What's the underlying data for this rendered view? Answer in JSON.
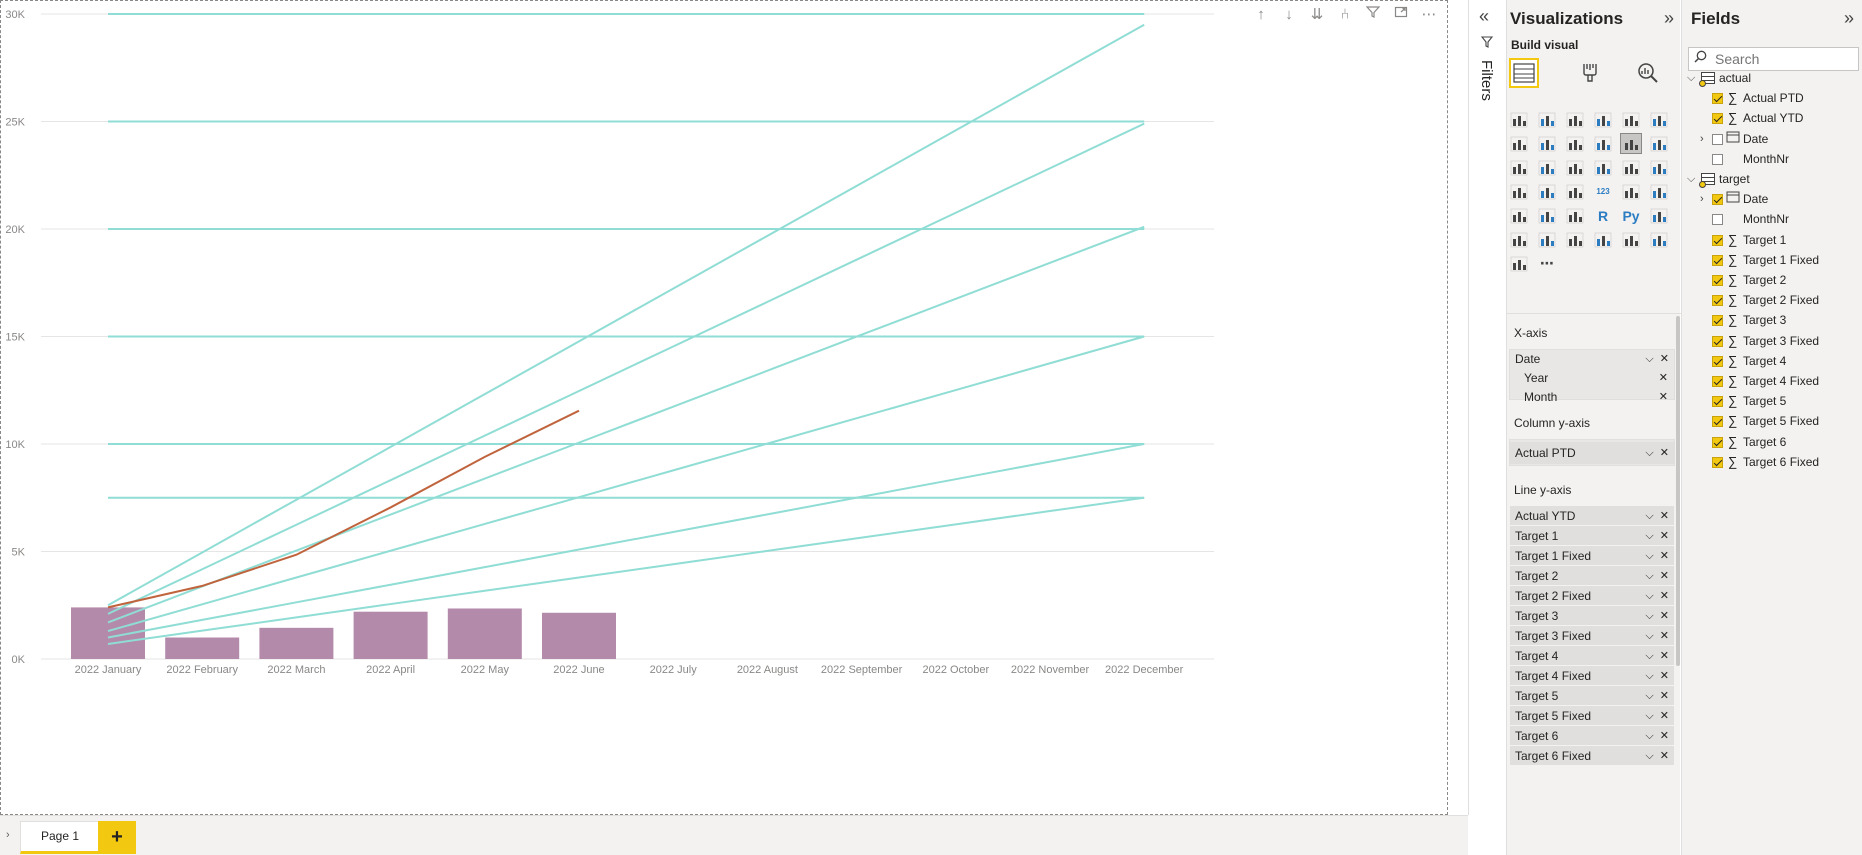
{
  "visual_header": {
    "icons": [
      "arrow-up-icon",
      "arrow-down-icon",
      "double-arrow-down-icon",
      "fork-icon",
      "filter-icon",
      "focus-mode-icon",
      "more-options-icon"
    ],
    "more_label": "⋯"
  },
  "chart_data": {
    "type": "bar-line-combo",
    "categories": [
      "2022 January",
      "2022 February",
      "2022 March",
      "2022 April",
      "2022 May",
      "2022 June",
      "2022 July",
      "2022 August",
      "2022 September",
      "2022 October",
      "2022 November",
      "2022 December"
    ],
    "y_ticks": [
      "0K",
      "5K",
      "10K",
      "15K",
      "20K",
      "25K",
      "30K"
    ],
    "ylim": [
      0,
      30000
    ],
    "grid": true,
    "bar_color": "#b48aab",
    "target_color": "#8fddd4",
    "actual_line_color": "#c0643d",
    "bars": {
      "name": "Actual PTD",
      "values": [
        2400,
        1000,
        1450,
        2200,
        2350,
        2150,
        null,
        null,
        null,
        null,
        null,
        null
      ]
    },
    "actual_line": {
      "name": "Actual YTD",
      "values": [
        2400,
        3400,
        4850,
        7050,
        9400,
        11550,
        null,
        null,
        null,
        null,
        null,
        null
      ]
    },
    "targets_growing": [
      {
        "name": "Target 1",
        "values": [
          2500,
          4955,
          7409,
          9864,
          12318,
          14773,
          17227,
          19682,
          22136,
          24591,
          27045,
          29500
        ]
      },
      {
        "name": "Target 2",
        "values": [
          2100,
          4173,
          6245,
          8318,
          10391,
          12464,
          14536,
          16609,
          18682,
          20755,
          22827,
          24900
        ]
      },
      {
        "name": "Target 3",
        "values": [
          1700,
          3373,
          5045,
          6718,
          8391,
          10064,
          11736,
          13409,
          15082,
          16755,
          18427,
          20100
        ]
      },
      {
        "name": "Target 4",
        "values": [
          1300,
          2545,
          3791,
          5036,
          6282,
          7527,
          8773,
          10018,
          11264,
          12509,
          13755,
          15000
        ]
      },
      {
        "name": "Target 5",
        "values": [
          1000,
          1818,
          2636,
          3455,
          4273,
          5091,
          5909,
          6727,
          7545,
          8364,
          9182,
          10000
        ]
      },
      {
        "name": "Target 6",
        "values": [
          700,
          1318,
          1936,
          2555,
          3173,
          3791,
          4409,
          5027,
          5645,
          6264,
          6882,
          7500
        ]
      }
    ],
    "targets_fixed": [
      {
        "name": "Target 1 Fixed",
        "value": 30000
      },
      {
        "name": "Target 2 Fixed",
        "value": 25000
      },
      {
        "name": "Target 3 Fixed",
        "value": 20000
      },
      {
        "name": "Target 4 Fixed",
        "value": 15000
      },
      {
        "name": "Target 5 Fixed",
        "value": 10000
      },
      {
        "name": "Target 6 Fixed",
        "value": 7500
      }
    ]
  },
  "filters": {
    "label": "Filters"
  },
  "visualizations": {
    "title": "Visualizations",
    "build_label": "Build visual",
    "wells": {
      "x_axis": {
        "title": "X-axis",
        "field": "Date",
        "sub_fields": [
          "Year",
          "Month"
        ]
      },
      "column_y": {
        "title": "Column y-axis",
        "fields": [
          "Actual PTD"
        ]
      },
      "line_y": {
        "title": "Line y-axis",
        "fields": [
          "Actual YTD",
          "Target 1",
          "Target 1 Fixed",
          "Target 2",
          "Target 2 Fixed",
          "Target 3",
          "Target 3 Fixed",
          "Target 4",
          "Target 4 Fixed",
          "Target 5",
          "Target 5 Fixed",
          "Target 6",
          "Target 6 Fixed"
        ]
      }
    }
  },
  "fields": {
    "title": "Fields",
    "search_placeholder": "Search",
    "tables": [
      {
        "name": "actual",
        "items": [
          {
            "label": "Actual PTD",
            "checked": true,
            "type": "measure"
          },
          {
            "label": "Actual YTD",
            "checked": true,
            "type": "measure"
          },
          {
            "label": "Date",
            "checked": false,
            "type": "date"
          },
          {
            "label": "MonthNr",
            "checked": false,
            "type": "plain"
          }
        ]
      },
      {
        "name": "target",
        "items": [
          {
            "label": "Date",
            "checked": true,
            "type": "date"
          },
          {
            "label": "MonthNr",
            "checked": false,
            "type": "plain"
          },
          {
            "label": "Target 1",
            "checked": true,
            "type": "measure"
          },
          {
            "label": "Target 1 Fixed",
            "checked": true,
            "type": "measure"
          },
          {
            "label": "Target 2",
            "checked": true,
            "type": "measure"
          },
          {
            "label": "Target 2 Fixed",
            "checked": true,
            "type": "measure"
          },
          {
            "label": "Target 3",
            "checked": true,
            "type": "measure"
          },
          {
            "label": "Target 3 Fixed",
            "checked": true,
            "type": "measure"
          },
          {
            "label": "Target 4",
            "checked": true,
            "type": "measure"
          },
          {
            "label": "Target 4 Fixed",
            "checked": true,
            "type": "measure"
          },
          {
            "label": "Target 5",
            "checked": true,
            "type": "measure"
          },
          {
            "label": "Target 5 Fixed",
            "checked": true,
            "type": "measure"
          },
          {
            "label": "Target 6",
            "checked": true,
            "type": "measure"
          },
          {
            "label": "Target 6 Fixed",
            "checked": true,
            "type": "measure"
          }
        ]
      }
    ]
  },
  "pages": {
    "tabs": [
      "Page 1"
    ],
    "add_label": "+"
  }
}
